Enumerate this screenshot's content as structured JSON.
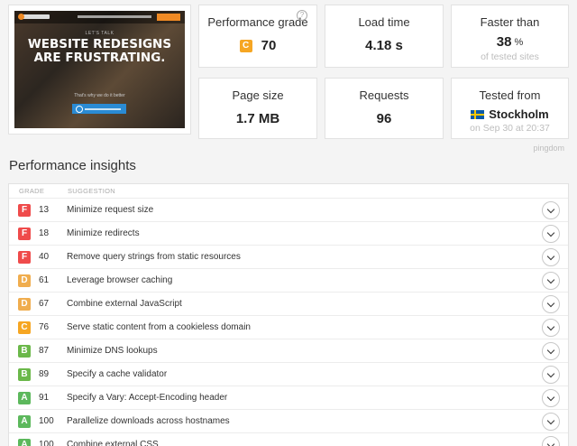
{
  "thumbnail": {
    "small_text": "LET'S TALK",
    "headline": "WEBSITE REDESIGNS ARE FRUSTRATING.",
    "sub_text": "That's why we do it better",
    "button_text": "WEBSITE REDESIGN GUIDE"
  },
  "metrics": {
    "performance": {
      "label": "Performance grade",
      "grade": "C",
      "value": "70",
      "grade_color": "#f6a623"
    },
    "load_time": {
      "label": "Load time",
      "value": "4.18 s"
    },
    "faster_than": {
      "label": "Faster than",
      "value": "38",
      "unit": "%",
      "sub": "of tested sites"
    },
    "page_size": {
      "label": "Page size",
      "value": "1.7 MB"
    },
    "requests": {
      "label": "Requests",
      "value": "96"
    },
    "tested_from": {
      "label": "Tested from",
      "value": "Stockholm",
      "sub": "on Sep 30 at 20:37"
    }
  },
  "pingdom_label": "pingdom",
  "insights": {
    "title": "Performance insights",
    "headers": {
      "grade": "GRADE",
      "suggestion": "SUGGESTION"
    },
    "rows": [
      {
        "grade": "F",
        "score": "13",
        "suggestion": "Minimize request size"
      },
      {
        "grade": "F",
        "score": "18",
        "suggestion": "Minimize redirects"
      },
      {
        "grade": "F",
        "score": "40",
        "suggestion": "Remove query strings from static resources"
      },
      {
        "grade": "D",
        "score": "61",
        "suggestion": "Leverage browser caching"
      },
      {
        "grade": "D",
        "score": "67",
        "suggestion": "Combine external JavaScript"
      },
      {
        "grade": "C",
        "score": "76",
        "suggestion": "Serve static content from a cookieless domain"
      },
      {
        "grade": "B",
        "score": "87",
        "suggestion": "Minimize DNS lookups"
      },
      {
        "grade": "B",
        "score": "89",
        "suggestion": "Specify a cache validator"
      },
      {
        "grade": "A",
        "score": "91",
        "suggestion": "Specify a Vary: Accept-Encoding header"
      },
      {
        "grade": "A",
        "score": "100",
        "suggestion": "Parallelize downloads across hostnames"
      },
      {
        "grade": "A",
        "score": "100",
        "suggestion": "Combine external CSS"
      }
    ]
  },
  "grade_colors": {
    "A": "#5cb85c",
    "B": "#6bb84a",
    "C": "#f6a623",
    "D": "#f0ad4e",
    "F": "#ef4b4b"
  }
}
